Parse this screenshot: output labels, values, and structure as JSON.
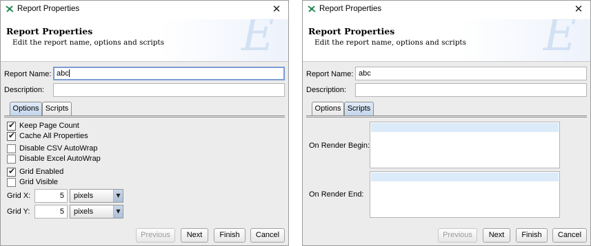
{
  "dialogs": [
    {
      "title": "Report Properties",
      "banner": {
        "title": "Report Properties",
        "subtitle": "Edit the report name, options and scripts",
        "logo_letter": "E"
      },
      "fields": {
        "name_label": "Report Name:",
        "name_value": "abc",
        "description_label": "Description:",
        "description_value": ""
      },
      "tabs": [
        {
          "label": "Options",
          "selected": true
        },
        {
          "label": "Scripts",
          "selected": false
        }
      ],
      "options": {
        "checkboxes": [
          {
            "label": "Keep Page Count",
            "checked": true
          },
          {
            "label": "Cache All Properties",
            "checked": true
          },
          {
            "label": "Disable CSV AutoWrap",
            "checked": false
          },
          {
            "label": "Disable Excel AutoWrap",
            "checked": false
          },
          {
            "label": "Grid Enabled",
            "checked": true
          },
          {
            "label": "Grid Visible",
            "checked": false
          }
        ],
        "grid_x": {
          "label": "Grid X:",
          "value": "5",
          "unit": "pixels"
        },
        "grid_y": {
          "label": "Grid Y:",
          "value": "5",
          "unit": "pixels"
        }
      },
      "buttons": {
        "previous": "Previous",
        "next": "Next",
        "finish": "Finish",
        "cancel": "Cancel"
      }
    },
    {
      "title": "Report Properties",
      "banner": {
        "title": "Report Properties",
        "subtitle": "Edit the report name, options and scripts",
        "logo_letter": "E"
      },
      "fields": {
        "name_label": "Report Name:",
        "name_value": "abc",
        "description_label": "Description:",
        "description_value": ""
      },
      "tabs": [
        {
          "label": "Options",
          "selected": false
        },
        {
          "label": "Scripts",
          "selected": true
        }
      ],
      "scripts": {
        "on_render_begin_label": "On Render Begin:",
        "on_render_begin_value": "",
        "on_render_end_label": "On Render End:",
        "on_render_end_value": ""
      },
      "buttons": {
        "previous": "Previous",
        "next": "Next",
        "finish": "Finish",
        "cancel": "Cancel"
      }
    }
  ],
  "icons": {
    "app": "report-properties-icon",
    "close": "close-icon",
    "check": "checkmark-icon",
    "dropdown": "chevron-down-icon"
  },
  "colors": {
    "accent": "#7a9cd3",
    "selected_tab": "#c2d5ec",
    "script_highlight": "#dcebfa",
    "logo": "#d3e1f4"
  }
}
